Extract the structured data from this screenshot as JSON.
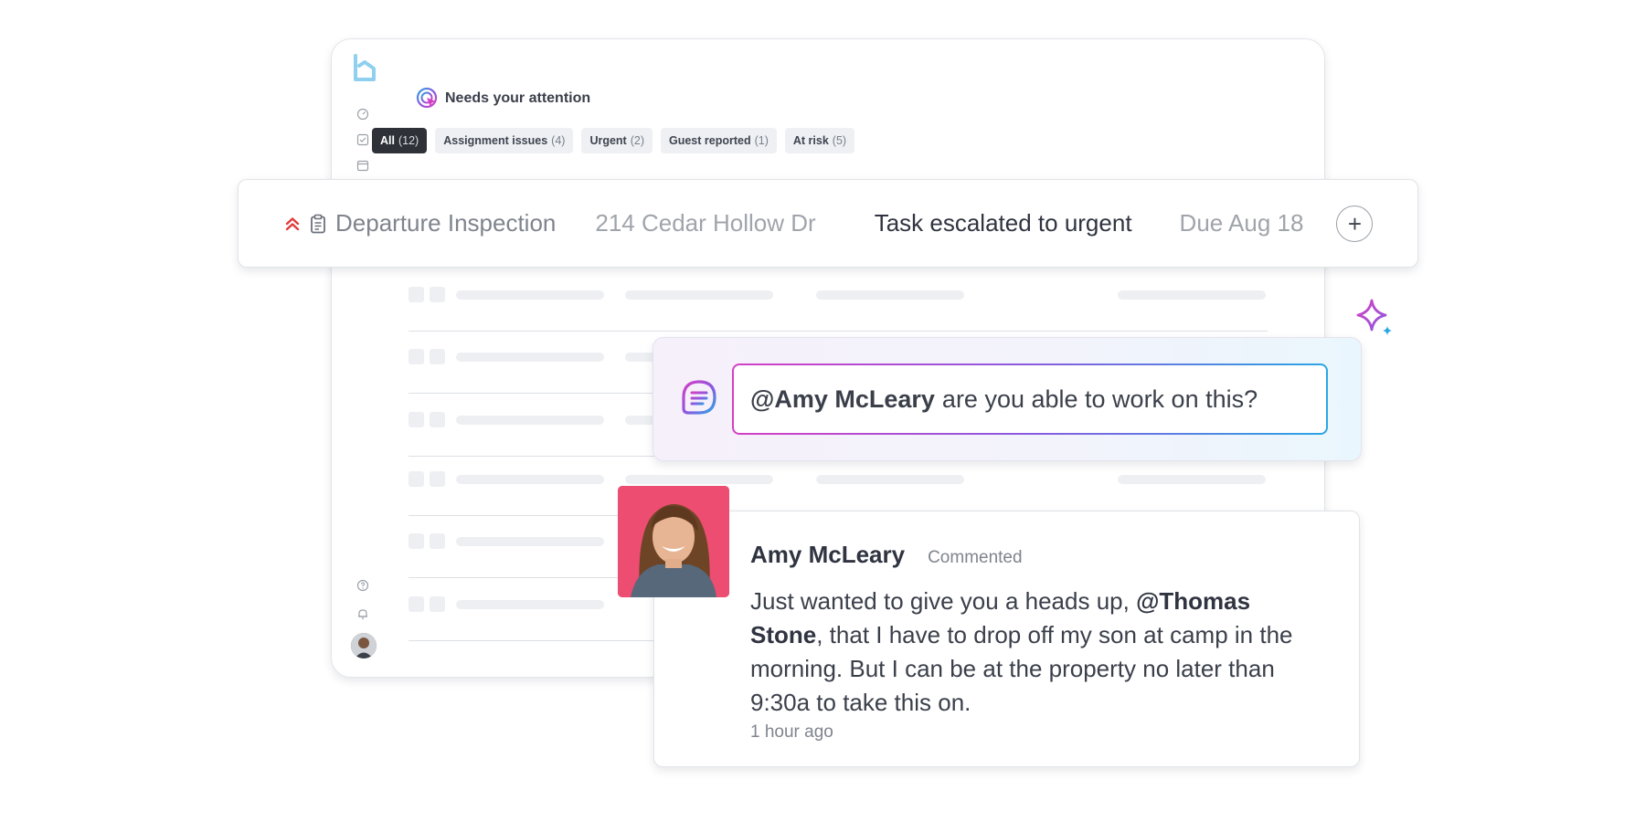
{
  "section": {
    "title": "Needs your attention"
  },
  "filters": [
    {
      "label": "All",
      "count": "(12)",
      "active": true
    },
    {
      "label": "Assignment issues",
      "count": "(4)",
      "active": false
    },
    {
      "label": "Urgent",
      "count": "(2)",
      "active": false
    },
    {
      "label": "Guest reported",
      "count": "(1)",
      "active": false
    },
    {
      "label": "At risk",
      "count": "(5)",
      "active": false
    }
  ],
  "task": {
    "name": "Departure Inspection",
    "address": "214 Cedar Hollow Dr",
    "status": "Task escalated to urgent",
    "due": "Due Aug 18",
    "add_symbol": "+",
    "priority_icon": "double-chevron-up-icon",
    "priority_color": "#e03a3a"
  },
  "comment_input": {
    "mention": "@Amy McLeary",
    "text": "are you able to work on this?"
  },
  "reply": {
    "author": "Amy McLeary",
    "action": "Commented",
    "body_before": "Just wanted to give you a heads up, ",
    "mention": "@Thomas Stone",
    "body_after": ", that I have to drop off my son at camp in the morning. But I can be at the property no later than 9:30a to take this on.",
    "time": "1 hour ago"
  },
  "colors": {
    "brand": "#8fd0ef",
    "accent_pink": "#d63fc4",
    "accent_purple": "#8a5ae0",
    "accent_blue": "#2aa6e4",
    "chip_active_bg": "#2e3238",
    "avatar_bg": "#ec4d70"
  }
}
